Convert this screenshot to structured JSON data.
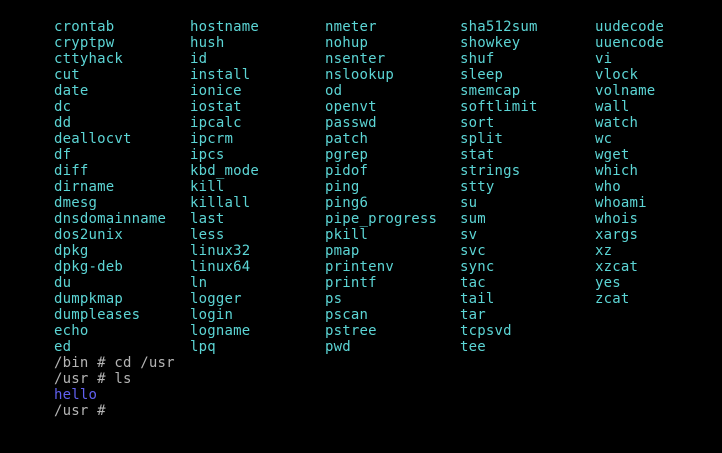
{
  "terminal": {
    "colors": {
      "background": "#000000",
      "executable": "#5cd5d5",
      "prompt_text": "#b4b4b4",
      "directory_entry": "#6060f0"
    },
    "columns": [
      [
        "crontab",
        "cryptpw",
        "cttyhack",
        "cut",
        "date",
        "dc",
        "dd",
        "deallocvt",
        "df",
        "diff",
        "dirname",
        "dmesg",
        "dnsdomainname",
        "dos2unix",
        "dpkg",
        "dpkg-deb",
        "du",
        "dumpkmap",
        "dumpleases",
        "echo",
        "ed"
      ],
      [
        "hostname",
        "hush",
        "id",
        "install",
        "ionice",
        "iostat",
        "ipcalc",
        "ipcrm",
        "ipcs",
        "kbd_mode",
        "kill",
        "killall",
        "last",
        "less",
        "linux32",
        "linux64",
        "ln",
        "logger",
        "login",
        "logname",
        "lpq"
      ],
      [
        "nmeter",
        "nohup",
        "nsenter",
        "nslookup",
        "od",
        "openvt",
        "passwd",
        "patch",
        "pgrep",
        "pidof",
        "ping",
        "ping6",
        "pipe_progress",
        "pkill",
        "pmap",
        "printenv",
        "printf",
        "ps",
        "pscan",
        "pstree",
        "pwd"
      ],
      [
        "sha512sum",
        "showkey",
        "shuf",
        "sleep",
        "smemcap",
        "softlimit",
        "sort",
        "split",
        "stat",
        "strings",
        "stty",
        "su",
        "sum",
        "sv",
        "svc",
        "sync",
        "tac",
        "tail",
        "tar",
        "tcpsvd",
        "tee"
      ],
      [
        "uudecode",
        "uuencode",
        "vi",
        "vlock",
        "volname",
        "wall",
        "watch",
        "wc",
        "wget",
        "which",
        "who",
        "whoami",
        "whois",
        "xargs",
        "xz",
        "xzcat",
        "yes",
        "zcat"
      ]
    ],
    "lines": [
      {
        "text": "/bin # cd /usr",
        "kind": "prompt"
      },
      {
        "text": "/usr # ls",
        "kind": "prompt"
      },
      {
        "text": "hello",
        "kind": "directory"
      },
      {
        "text": "/usr #",
        "kind": "prompt"
      }
    ]
  }
}
